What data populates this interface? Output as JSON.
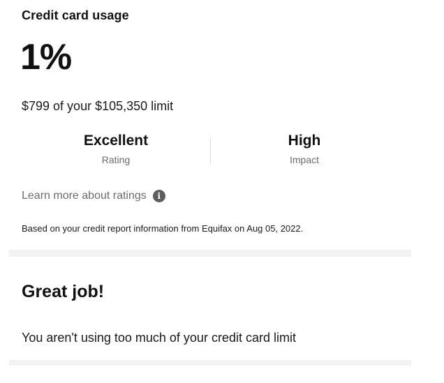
{
  "card": {
    "title": "Credit card usage",
    "percent": "1%",
    "limit_text": "$799 of your $105,350 limit",
    "rating": {
      "value": "Excellent",
      "label": "Rating"
    },
    "impact": {
      "value": "High",
      "label": "Impact"
    },
    "learn_more": "Learn more about ratings",
    "info_icon": "info-icon",
    "info_glyph": "i",
    "source_note": "Based on your credit report information from Equifax on Aug 05, 2022."
  },
  "feedback": {
    "heading": "Great job!",
    "message": "You aren't using too much of your credit card limit"
  },
  "colors": {
    "text": "#111111",
    "muted": "#6b6b6b",
    "separator": "#f2f2f2",
    "icon_bg": "#5e5e5e"
  }
}
